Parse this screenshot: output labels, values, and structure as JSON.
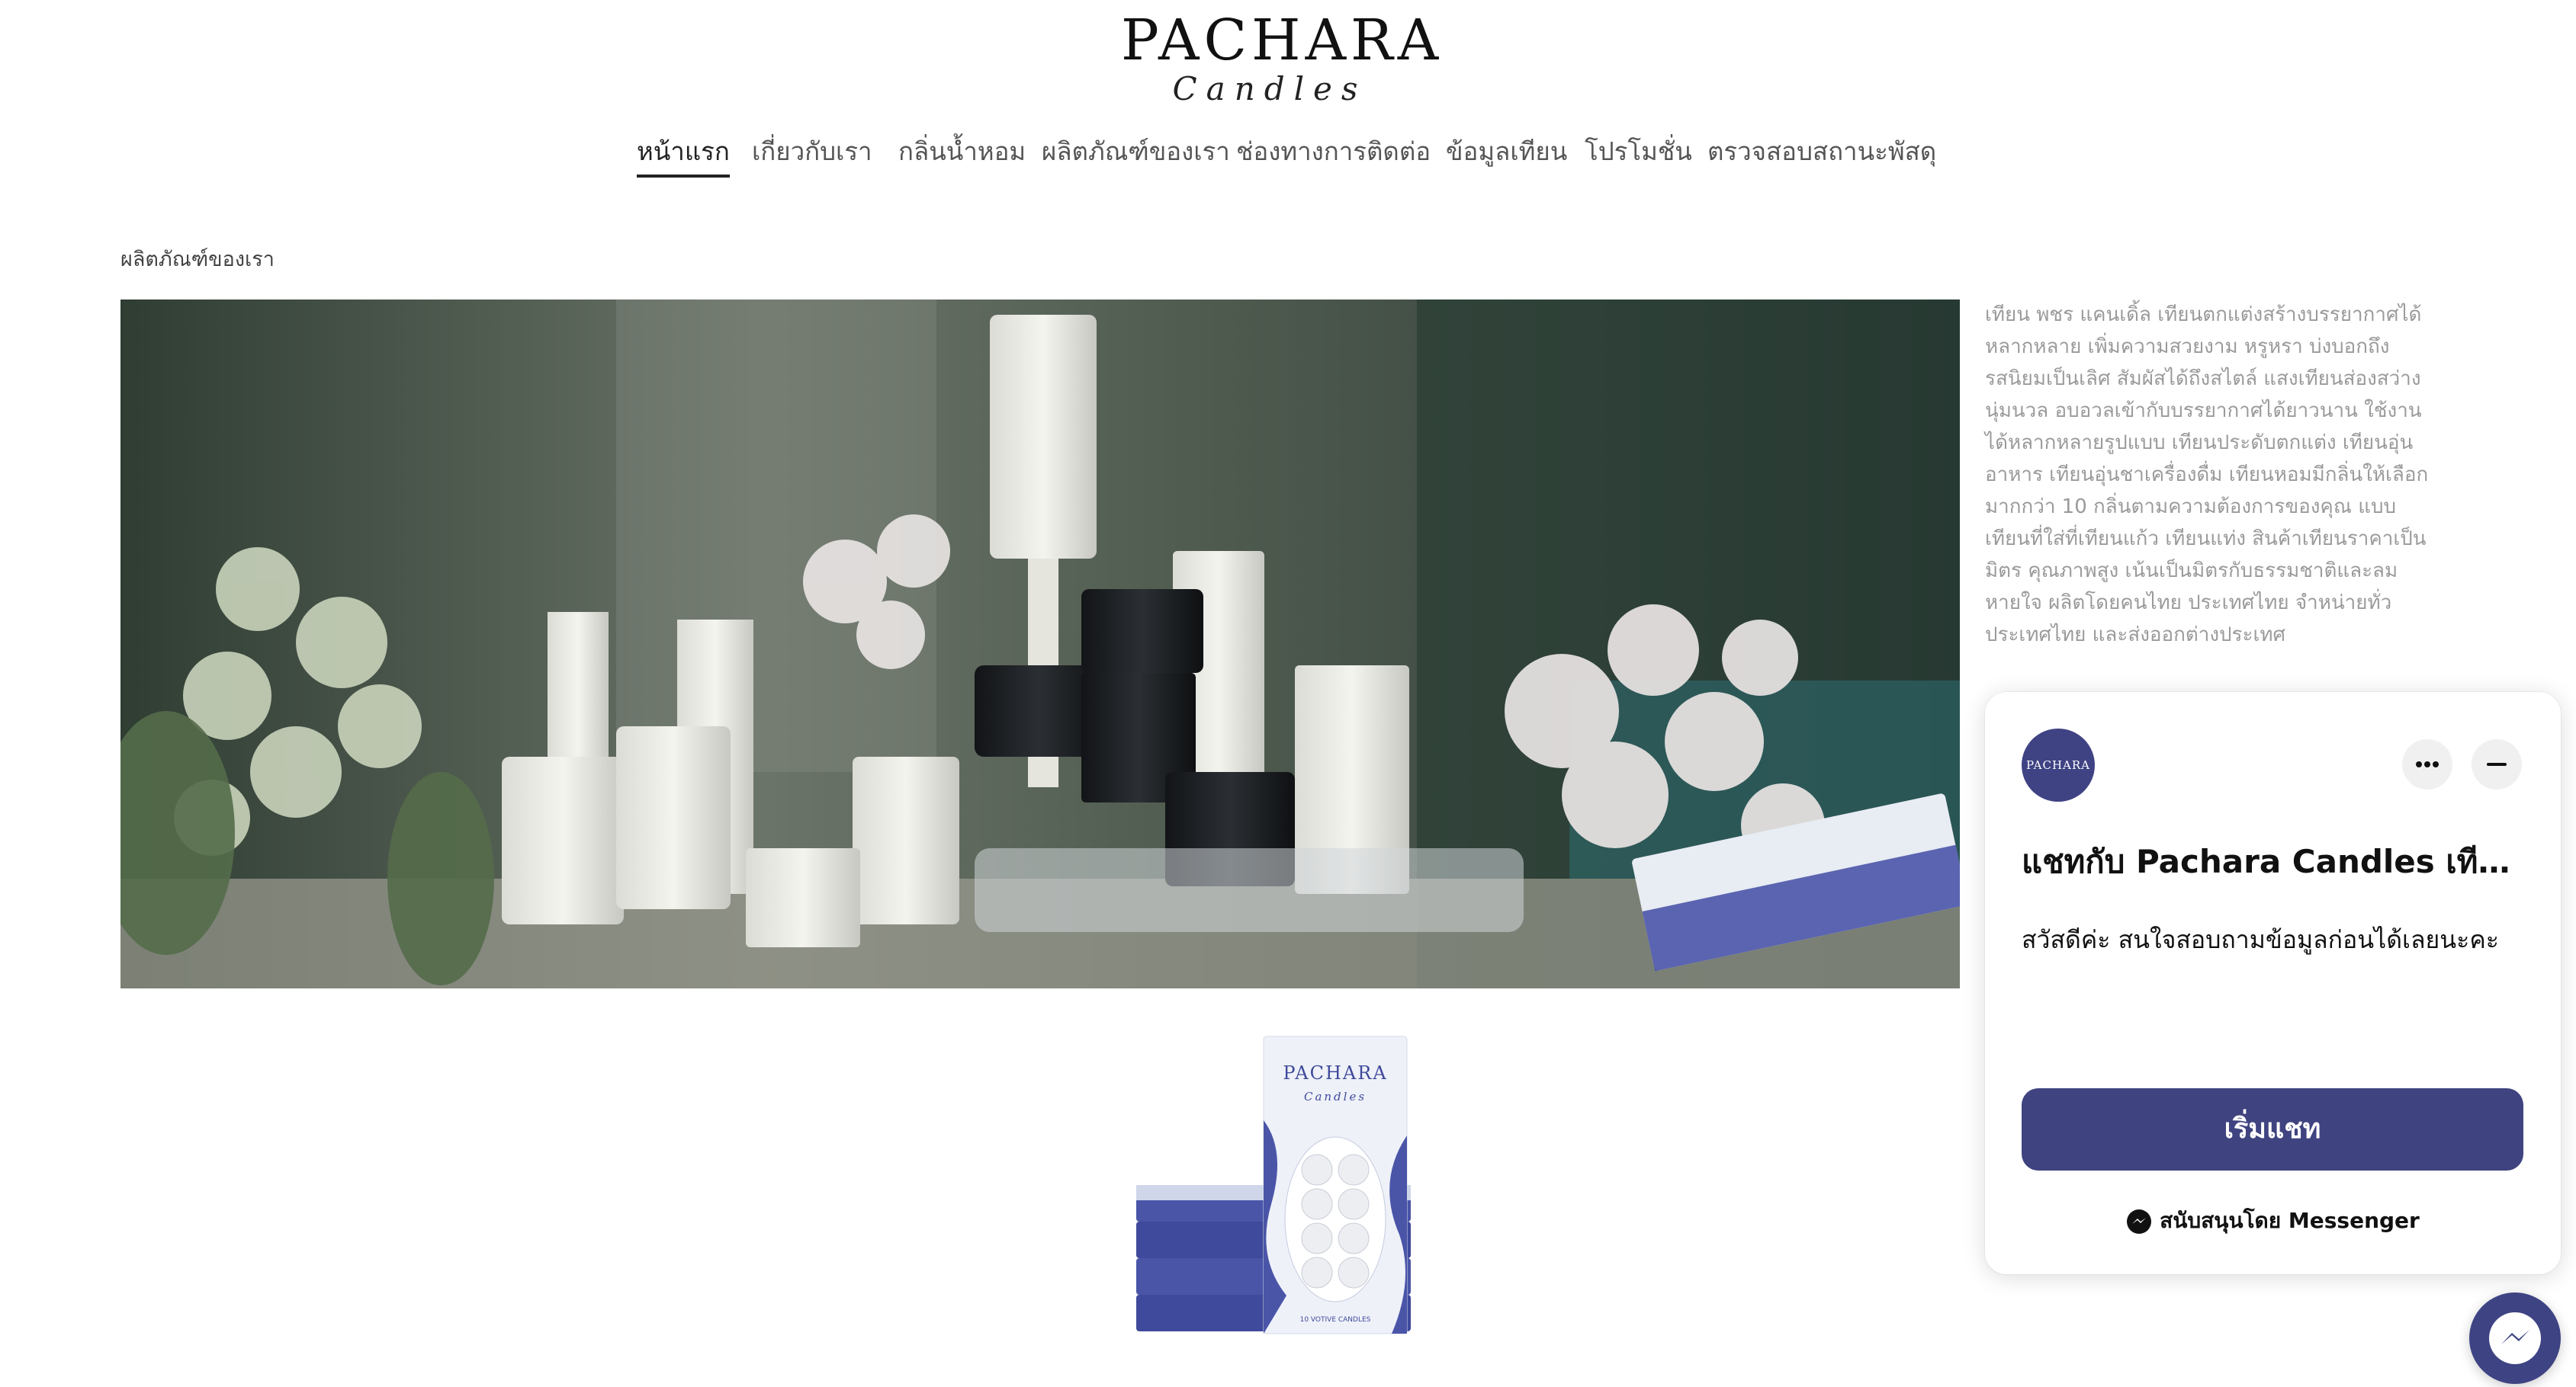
{
  "brand": {
    "name": "PACHARA",
    "tagline": "Candles"
  },
  "nav": {
    "items": [
      {
        "label": "หน้าแรก",
        "active": true
      },
      {
        "label": "เกี่ยวกับเรา"
      },
      {
        "label": "กลิ่นน้ำหอม"
      },
      {
        "label": "ผลิตภัณฑ์ของเรา"
      },
      {
        "label": "ช่องทางการติดต่อ"
      },
      {
        "label": "ข้อมูลเทียน"
      },
      {
        "label": "โปรโมชั่น"
      },
      {
        "label": "ตรวจสอบสถานะพัสดุ"
      }
    ]
  },
  "breadcrumb": "ผลิตภัณฑ์ของเรา",
  "description": "เทียน พชร แคนเดิ้ล เทียนตกแต่งสร้างบรรยากาศได้หลากหลาย เพิ่มความสวยงาม หรูหรา บ่งบอกถึงรสนิยมเป็นเลิศ สัมผัสได้ถึงสไตล์ แสงเทียนส่องสว่างนุ่มนวล อบอวลเข้ากับบรรยากาศได้ยาวนาน ใช้งานได้หลากหลายรูปแบบ เทียนประดับตกแต่ง เทียนอุ่นอาหาร เทียนอุ่นชาเครื่องดื่ม เทียนหอมมีกลิ่นให้เลือกมากกว่า 10 กลิ่นตามความต้องการของคุณ แบบเทียนที่ใส่ที่เทียนแก้ว เทียนแท่ง สินค้าเทียนราคาเป็นมิตร คุณภาพสูง เน้นเป็นมิตรกับธรรมชาติและลมหายใจ ผลิตโดยคนไทย ประเทศไทย จำหน่ายทั่วประเทศไทย และส่งออกต่างประเทศ",
  "product_box": {
    "brand": "PACHARA",
    "tagline": "Candles",
    "label": "10 VOTIVE CANDLES"
  },
  "chat": {
    "avatar_text": "PACHARA",
    "more_icon": "more-horizontal-icon",
    "minimize_icon": "minus-icon",
    "title": "แชทกับ Pachara Candles เทียนหอม",
    "greeting": "สวัสดีค่ะ สนใจสอบถามข้อมูลก่อนได้เลยนะคะ",
    "start_label": "เริ่มแชท",
    "powered_by": "สนับสนุนโดย Messenger",
    "accent": "#3f4380"
  }
}
